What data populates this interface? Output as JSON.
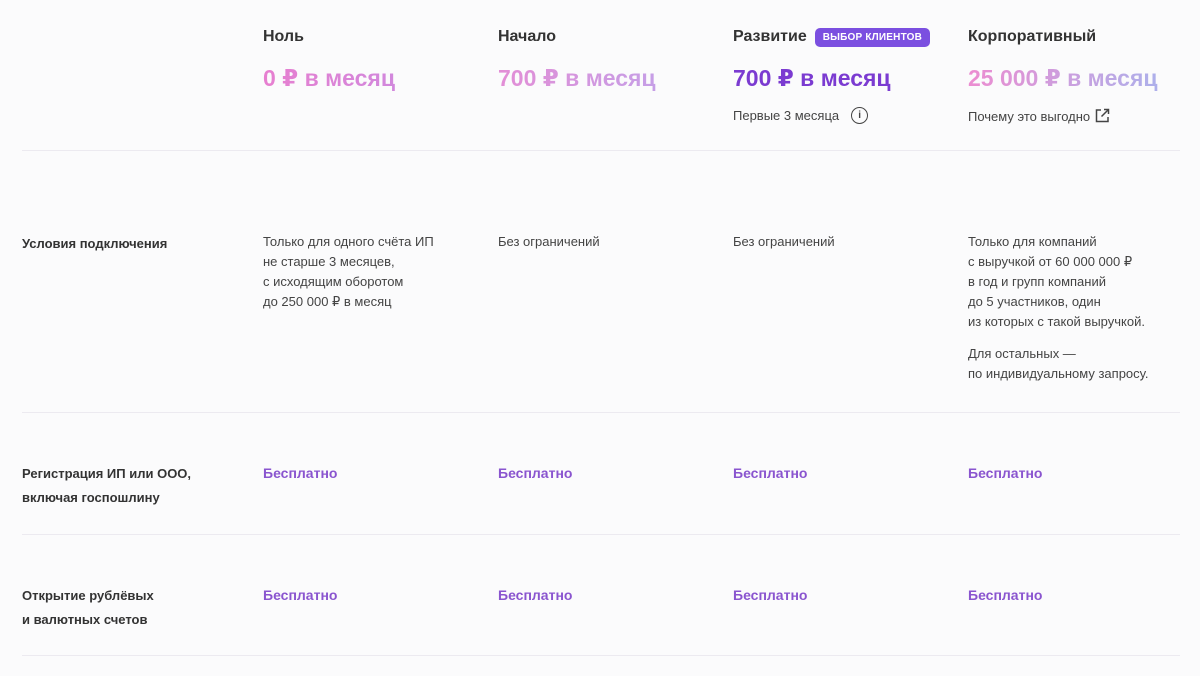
{
  "plans": [
    {
      "name": "Ноль",
      "price": "0 ₽ в месяц"
    },
    {
      "name": "Начало",
      "price": "700 ₽ в месяц"
    },
    {
      "name": "Развитие",
      "badge": "ВЫБОР КЛИЕНТОВ",
      "price": "700 ₽ в месяц",
      "note": "Первые 3 месяца"
    },
    {
      "name": "Корпоративный",
      "price": "25 000 ₽ в месяц",
      "link": "Почему это выгодно"
    }
  ],
  "rows": {
    "conditions": {
      "label": "Условия подключения",
      "values": [
        [
          "Только для одного счёта ИП",
          "не старше 3 месяцев,",
          "с исходящим оборотом",
          "до 250 000 ₽ в месяц"
        ],
        [
          "Без ограничений"
        ],
        [
          "Без ограничений"
        ],
        [
          "Только для компаний",
          "с выручкой от 60 000 000 ₽",
          "в год и групп компаний",
          "до 5 участников, один",
          "из которых с такой выручкой."
        ]
      ],
      "extra": [
        "Для остальных —",
        "по индивидуальному запросу."
      ]
    },
    "registration": {
      "label": [
        "Регистрация ИП или ООО,",
        "включая госпошлину"
      ],
      "values": [
        "Бесплатно",
        "Бесплатно",
        "Бесплатно",
        "Бесплатно"
      ]
    },
    "accounts": {
      "label": [
        "Открытие рублёвых",
        "и валютных счетов"
      ],
      "values": [
        "Бесплатно",
        "Бесплатно",
        "Бесплатно",
        "Бесплатно"
      ]
    }
  },
  "colors": {
    "accent": "#7b3bd1",
    "badge": "#7b4fe0",
    "free_text": "#8a55cf"
  },
  "icons": {
    "info": "info-icon",
    "external": "external-link-icon"
  }
}
